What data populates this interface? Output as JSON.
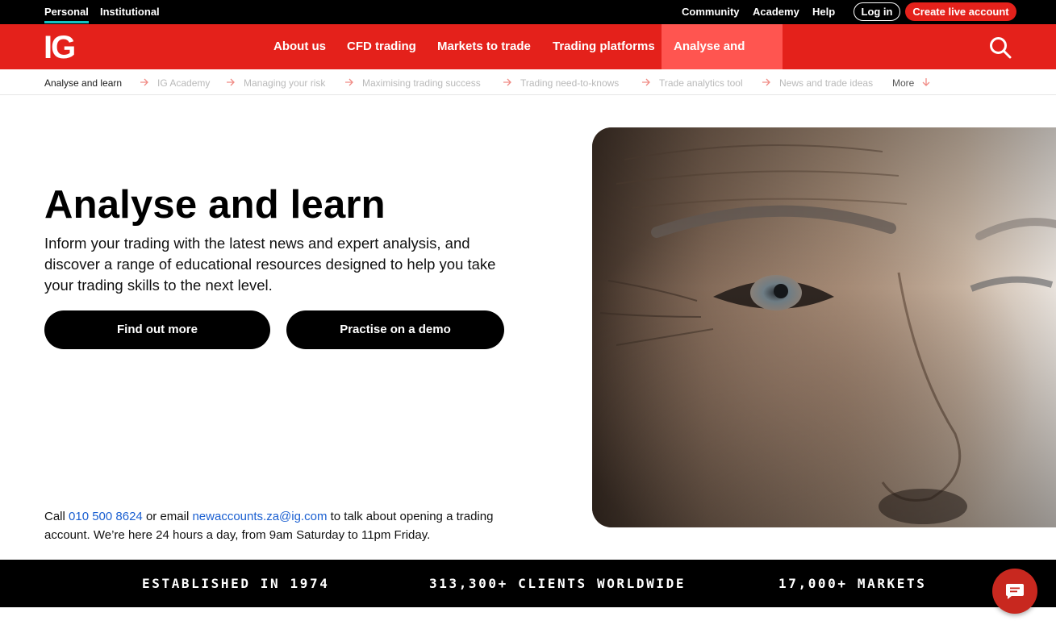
{
  "top_bar": {
    "audience_tabs": [
      "Personal",
      "Institutional"
    ],
    "links": [
      "Community",
      "Academy",
      "Help"
    ],
    "login_label": "Log in",
    "create_account_label": "Create live account"
  },
  "main_nav": {
    "logo": "IG",
    "items": [
      "About us",
      "CFD trading",
      "Markets to trade",
      "Trading platforms",
      "Analyse and learn"
    ],
    "active": "Analyse and learn"
  },
  "sub_nav": {
    "current": "Analyse and learn",
    "items": [
      "IG Academy",
      "Managing your risk",
      "Maximising trading success",
      "Trading need-to-knows",
      "Trade analytics tool",
      "News and trade ideas"
    ],
    "more_label": "More"
  },
  "hero": {
    "title": "Analyse and learn",
    "description": "Inform your trading with the latest news and expert analysis, and discover a range of educational resources designed to help you take your trading skills to the next level.",
    "primary_button": "Find out more",
    "secondary_button": "Practise on a demo"
  },
  "contact": {
    "call_prefix": "Call ",
    "phone": "010 500 8624",
    "email_prefix": " or email ",
    "email": "newaccounts.za@ig.com",
    "suffix": " to talk about opening a trading account. We’re here 24 hours a day, from 9am Saturday to 11pm Friday."
  },
  "stats": [
    "ESTABLISHED IN 1974",
    "313,300+ CLIENTS WORLDWIDE",
    "17,000+ MARKETS"
  ],
  "colors": {
    "brand_red": "#e4211b",
    "active_nav": "#ff5550",
    "link_blue": "#1a5fd1",
    "accent_teal": "#13c2c2"
  },
  "icons": [
    "search-icon",
    "arrow-right-icon",
    "arrow-down-icon",
    "chat-icon"
  ]
}
